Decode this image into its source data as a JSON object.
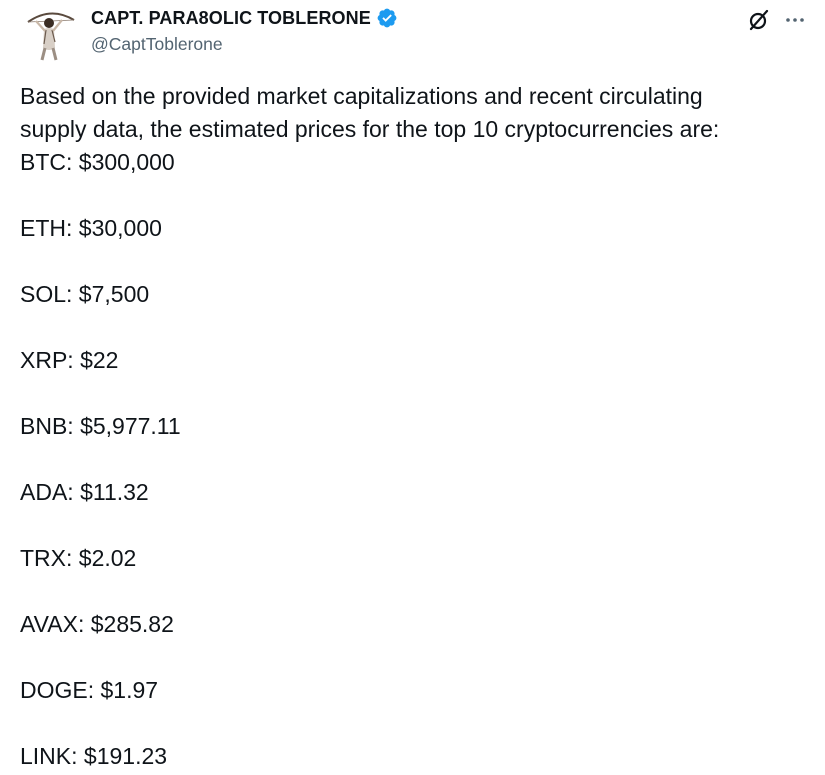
{
  "author": {
    "display_name": "CAPT. PARA8OLIC TOBLERONE",
    "handle": "@CaptToblerone",
    "verified": true,
    "verified_color": "#1d9bf0"
  },
  "icons": {
    "avatar": "archer-figure-avatar",
    "verified": "verified-badge-icon",
    "grok": "grok-slash-circle-icon",
    "more": "more-horizontal-icon"
  },
  "tweet": {
    "intro_line1": "Based on the provided market capitalizations and recent circulating",
    "intro_line2": "supply data, the estimated prices for the top 10 cryptocurrencies are:",
    "prices": [
      "BTC: $300,000",
      "ETH: $30,000",
      "SOL: $7,500",
      "XRP: $22",
      "BNB: $5,977.11",
      "ADA: $11.32",
      "TRX: $2.02",
      "AVAX: $285.82",
      "DOGE: $1.97",
      "LINK: $191.23"
    ]
  },
  "colors": {
    "text": "#0f1419",
    "secondary_text": "#536471",
    "background": "#ffffff"
  }
}
